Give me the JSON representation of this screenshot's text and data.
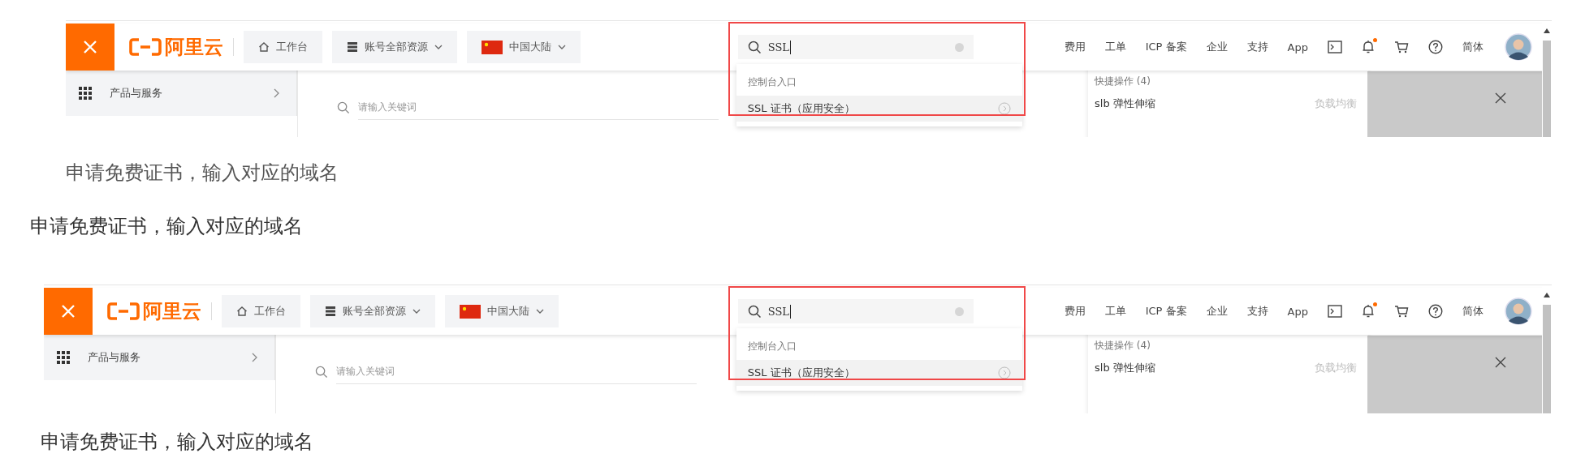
{
  "blocks": [
    {
      "kind": "screenshot",
      "logo": "阿里云",
      "topbar_buttons": [
        {
          "label": "工作台",
          "dropdown": false
        },
        {
          "label": "账号全部资源",
          "dropdown": true
        },
        {
          "label": "中国大陆",
          "dropdown": true
        }
      ],
      "search": {
        "value": "SSL",
        "highlighted": true
      },
      "nav": [
        {
          "kind": "text",
          "label": "费用"
        },
        {
          "kind": "text",
          "label": "工单"
        },
        {
          "kind": "text",
          "label": "ICP 备案"
        },
        {
          "kind": "text",
          "label": "企业"
        },
        {
          "kind": "text",
          "label": "支持"
        },
        {
          "kind": "text",
          "label": "App"
        },
        {
          "kind": "terminal"
        },
        {
          "kind": "bell",
          "badge": true
        },
        {
          "kind": "cart"
        },
        {
          "kind": "help"
        },
        {
          "kind": "text",
          "label": "简体"
        },
        {
          "kind": "avatar"
        }
      ],
      "sidebar": {
        "label": "产品与服务"
      },
      "content_search": {
        "placeholder": "请输入关键词"
      },
      "search_dropdown": {
        "heading": "控制台入口",
        "items": [
          {
            "label": "SSL 证书（应用安全）",
            "selected": true
          }
        ]
      },
      "quick_panel": {
        "heading": "快捷操作 (4)",
        "items": [
          {
            "label": "slb 弹性伸缩",
            "tag": "负载均衡"
          }
        ]
      }
    },
    {
      "kind": "caption",
      "text": "申请免费证书，输入对应的域名",
      "blurred": true
    },
    {
      "kind": "caption",
      "text": "申请免费证书，输入对应的域名",
      "blurred": false
    },
    {
      "kind": "screenshot",
      "logo": "阿里云",
      "topbar_buttons": [
        {
          "label": "工作台",
          "dropdown": false
        },
        {
          "label": "账号全部资源",
          "dropdown": true
        },
        {
          "label": "中国大陆",
          "dropdown": true
        }
      ],
      "search": {
        "value": "SSL",
        "highlighted": true
      },
      "nav": [
        {
          "kind": "text",
          "label": "费用"
        },
        {
          "kind": "text",
          "label": "工单"
        },
        {
          "kind": "text",
          "label": "ICP 备案"
        },
        {
          "kind": "text",
          "label": "企业"
        },
        {
          "kind": "text",
          "label": "支持"
        },
        {
          "kind": "text",
          "label": "App"
        },
        {
          "kind": "terminal"
        },
        {
          "kind": "bell",
          "badge": true
        },
        {
          "kind": "cart"
        },
        {
          "kind": "help"
        },
        {
          "kind": "text",
          "label": "简体"
        },
        {
          "kind": "avatar"
        }
      ],
      "sidebar": {
        "label": "产品与服务"
      },
      "content_search": {
        "placeholder": "请输入关键词"
      },
      "search_dropdown": {
        "heading": "控制台入口",
        "items": [
          {
            "label": "SSL 证书（应用安全）",
            "selected": true
          }
        ]
      },
      "quick_panel": {
        "heading": "快捷操作 (4)",
        "items": [
          {
            "label": "slb 弹性伸缩",
            "tag": "负载均衡"
          }
        ]
      }
    },
    {
      "kind": "caption",
      "text": "申请免费证书，输入对应的域名",
      "blurred": false
    }
  ]
}
